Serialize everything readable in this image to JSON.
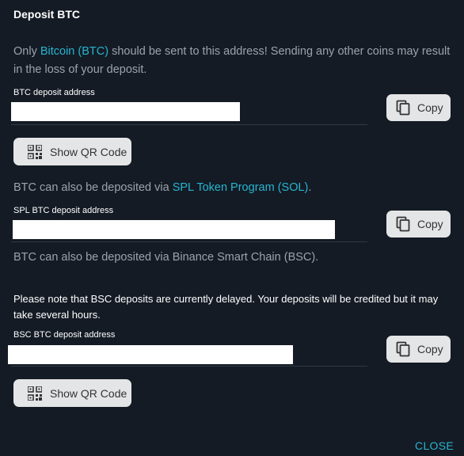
{
  "dialog": {
    "title": "Deposit BTC",
    "close_label": "CLOSE"
  },
  "intro": {
    "prefix": "Only ",
    "link": "Bitcoin (BTC)",
    "suffix": " should be sent to this address! Sending any other coins may result in the loss of your deposit."
  },
  "btc": {
    "label": "BTC deposit address",
    "address": "",
    "copy_label": "Copy",
    "qr_label": "Show QR Code"
  },
  "spl": {
    "info_prefix": "BTC can also be deposited via ",
    "info_link": "SPL Token Program (SOL)",
    "info_suffix": ".",
    "label": "SPL BTC deposit address",
    "address": "",
    "copy_label": "Copy"
  },
  "bsc": {
    "info": "BTC can also be deposited via Binance Smart Chain (BSC).",
    "note": "Please note that BSC deposits are currently delayed. Your deposits will be credited but it may take several hours.",
    "label": "BSC BTC deposit address",
    "address": "",
    "copy_label": "Copy",
    "qr_label": "Show QR Code"
  },
  "icons": {
    "copy": "copy-icon",
    "qr": "qr-code-icon"
  },
  "colors": {
    "background": "#141b25",
    "link": "#27b5cf",
    "muted_text": "#9aa3ab",
    "button_bg": "#e4e5e6"
  }
}
